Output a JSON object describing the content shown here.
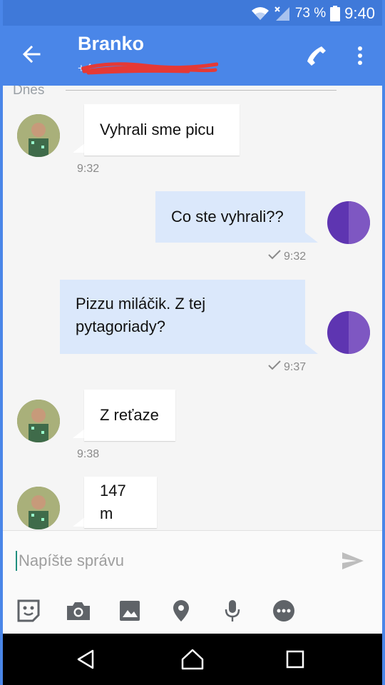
{
  "status_bar": {
    "battery_percent": "73 %",
    "time": "9:40",
    "icons": [
      "wifi-icon",
      "no-sim-signal-icon",
      "battery-icon"
    ]
  },
  "app_bar": {
    "contact_name": "Branko",
    "contact_number": "+4",
    "icons": [
      "back-arrow-icon",
      "phone-icon",
      "more-vert-icon"
    ]
  },
  "conversation": {
    "date_label": "Dnes",
    "messages": [
      {
        "direction": "incoming",
        "text": "Vyhrali sme picu",
        "time": "9:32"
      },
      {
        "direction": "outgoing",
        "text": "Co ste vyhrali??",
        "time": "9:32"
      },
      {
        "direction": "outgoing",
        "text": "Pizzu miláčik. Z tej pytagoriady?",
        "line1": "Pizzu miláčik. Z tej",
        "line2": "pytagoriady?",
        "time": "9:37"
      },
      {
        "direction": "incoming",
        "text": "Z reťaze",
        "time": "9:38"
      },
      {
        "direction": "incoming",
        "text": "147 m",
        "time": ""
      }
    ]
  },
  "composer": {
    "placeholder": "Napíšte správu",
    "tools": [
      "sticker-icon",
      "camera-icon",
      "gallery-icon",
      "location-icon",
      "microphone-icon",
      "more-options-icon"
    ],
    "send_icon": "send-icon"
  },
  "nav_bar": {
    "icons": [
      "nav-back-icon",
      "nav-home-icon",
      "nav-recents-icon"
    ]
  },
  "colors": {
    "app_bar": "#4a86e8",
    "status_bar": "#3f79d9",
    "outgoing_bubble": "#dbe8fb",
    "incoming_bubble": "#ffffff",
    "own_avatar": "#5e35b1"
  }
}
